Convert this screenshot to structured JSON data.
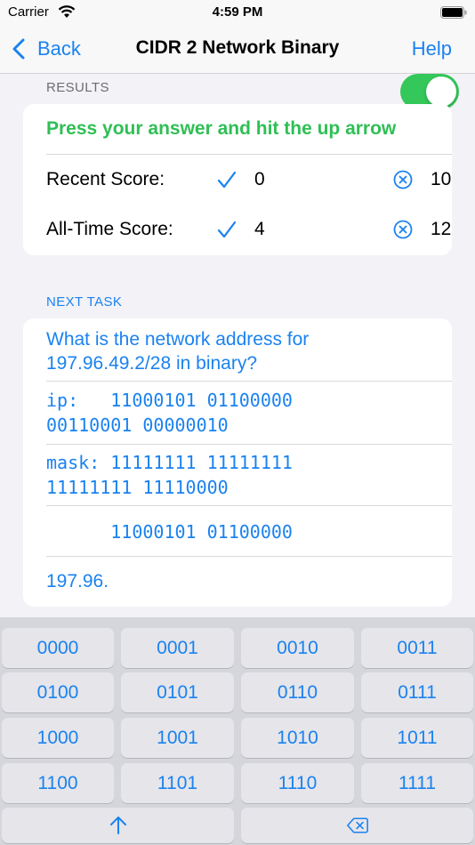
{
  "status_bar": {
    "carrier": "Carrier",
    "time": "4:59 PM"
  },
  "nav": {
    "back_label": "Back",
    "title": "CIDR 2 Network Binary",
    "help_label": "Help"
  },
  "results": {
    "section_label": "RESULTS",
    "toggle_on": true,
    "instruction": "Press your answer and hit the up arrow",
    "recent": {
      "label": "Recent Score:",
      "correct": "0",
      "wrong": "10"
    },
    "all_time": {
      "label": "All-Time Score:",
      "correct": "4",
      "wrong": "12"
    }
  },
  "task": {
    "section_label": "NEXT TASK",
    "question": "What is the network address for 197.96.49.2/28 in binary?",
    "ip_text": "ip:   11000101 01100000\n00110001 00000010",
    "mask_text": "mask: 11111111 11111111\n11111111 11110000",
    "result_text": "      11000101 01100000",
    "answer": "197.96."
  },
  "keypad": {
    "keys": [
      "0000",
      "0001",
      "0010",
      "0011",
      "0100",
      "0101",
      "0110",
      "0111",
      "1000",
      "1001",
      "1010",
      "1011",
      "1100",
      "1101",
      "1110",
      "1111"
    ],
    "submit_icon": "up-arrow-icon",
    "delete_icon": "backspace-icon"
  },
  "colors": {
    "accent": "#1a82f0",
    "success": "#2fbf55",
    "toggle": "#34c759"
  }
}
